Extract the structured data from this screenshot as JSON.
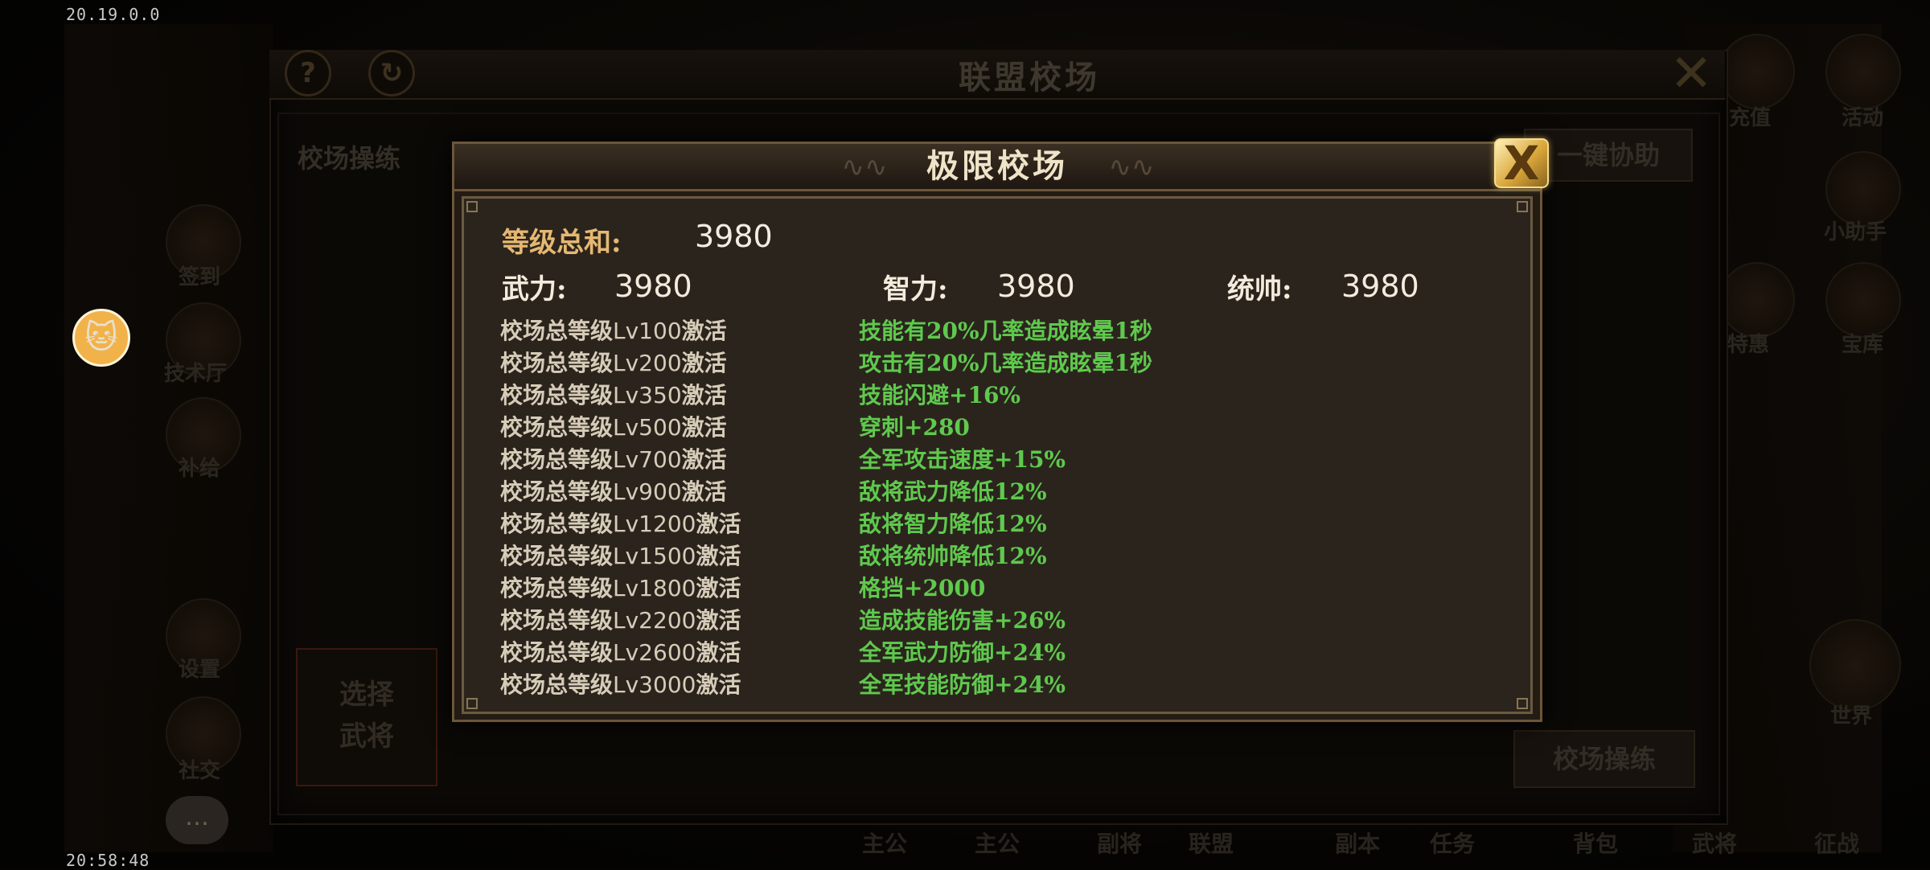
{
  "status": {
    "version": "20.19.0.0",
    "clock": "20:58:48"
  },
  "background": {
    "panel_title": "联盟校场",
    "help_icon": "?",
    "refresh_icon": "↻",
    "tab_label": "校场操练",
    "assist_button": "一键协助",
    "drill_button": "校场操练",
    "select_general_button": [
      "选择",
      "武将"
    ],
    "left_side_labels": [
      "签到",
      "技术厅",
      "补给",
      "设置",
      "社交"
    ],
    "right_side_labels": [
      "充值",
      "活动",
      "小助手",
      "特惠",
      "宝库",
      "世界"
    ],
    "bottom_nav": [
      "主公",
      "主公",
      "副将",
      "联盟",
      "副本",
      "任务",
      "背包",
      "武将",
      "征战"
    ]
  },
  "dialog": {
    "title": "极限校场",
    "close_label": "X",
    "level_sum_label": "等级总和:",
    "level_sum_value": "3980",
    "stats": [
      {
        "label": "武力:",
        "value": "3980"
      },
      {
        "label": "智力:",
        "value": "3980"
      },
      {
        "label": "统帅:",
        "value": "3980"
      }
    ],
    "rows": [
      {
        "prefix": "校场总等级",
        "level": "Lv100",
        "suffix": "激活",
        "effect": "技能有20%几率造成眩晕1秒"
      },
      {
        "prefix": "校场总等级",
        "level": "Lv200",
        "suffix": "激活",
        "effect": "攻击有20%几率造成眩晕1秒"
      },
      {
        "prefix": "校场总等级",
        "level": "Lv350",
        "suffix": "激活",
        "effect": "技能闪避+16%"
      },
      {
        "prefix": "校场总等级",
        "level": "Lv500",
        "suffix": "激活",
        "effect": "穿刺+280"
      },
      {
        "prefix": "校场总等级",
        "level": "Lv700",
        "suffix": "激活",
        "effect": "全军攻击速度+15%"
      },
      {
        "prefix": "校场总等级",
        "level": "Lv900",
        "suffix": "激活",
        "effect": "敌将武力降低12%"
      },
      {
        "prefix": "校场总等级",
        "level": "Lv1200",
        "suffix": "激活",
        "effect": "敌将智力降低12%"
      },
      {
        "prefix": "校场总等级",
        "level": "Lv1500",
        "suffix": "激活",
        "effect": "敌将统帅降低12%"
      },
      {
        "prefix": "校场总等级",
        "level": "Lv1800",
        "suffix": "激活",
        "effect": "格挡+2000"
      },
      {
        "prefix": "校场总等级",
        "level": "Lv2200",
        "suffix": "激活",
        "effect": "造成技能伤害+26%"
      },
      {
        "prefix": "校场总等级",
        "level": "Lv2600",
        "suffix": "激活",
        "effect": "全军武力防御+24%"
      },
      {
        "prefix": "校场总等级",
        "level": "Lv3000",
        "suffix": "激活",
        "effect": "全军技能防御+24%"
      }
    ]
  },
  "colors": {
    "effect_green": "#5fc94d",
    "sum_label_gold": "#e5b872",
    "close_gold": "#d9a63a"
  }
}
